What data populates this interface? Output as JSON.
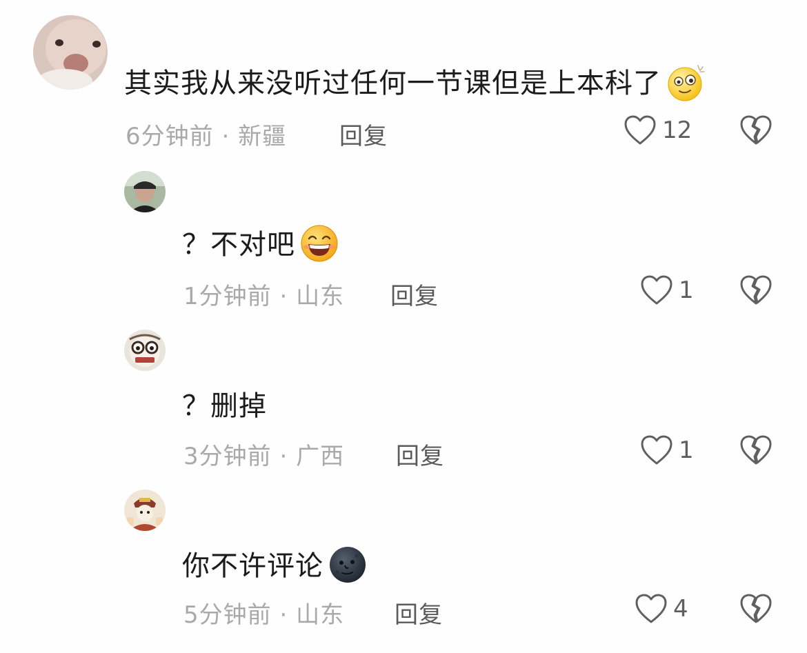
{
  "colors": {
    "background": "#fefefe",
    "text": "#1b1b1b",
    "meta": "#a9a9a9",
    "action": "#5a5a5a"
  },
  "comments": [
    {
      "text": "其实我从来没听过任何一节课但是上本科了",
      "emoji": "dizzy-face-emoji",
      "time": "6分钟前",
      "location": "新疆",
      "separator": "·",
      "reply_label": "回复",
      "likes": "12"
    },
    {
      "text": "？不对吧",
      "emoji": "grinning-squint-emoji",
      "time": "1分钟前",
      "location": "山东",
      "separator": "·",
      "reply_label": "回复",
      "likes": "1"
    },
    {
      "text": "？删掉",
      "emoji": "",
      "time": "3分钟前",
      "location": "广西",
      "separator": "·",
      "reply_label": "回复",
      "likes": "1"
    },
    {
      "text": "你不许评论",
      "emoji": "new-moon-face-emoji",
      "time": "5分钟前",
      "location": "山东",
      "separator": "·",
      "reply_label": "回复",
      "likes": "4"
    }
  ]
}
